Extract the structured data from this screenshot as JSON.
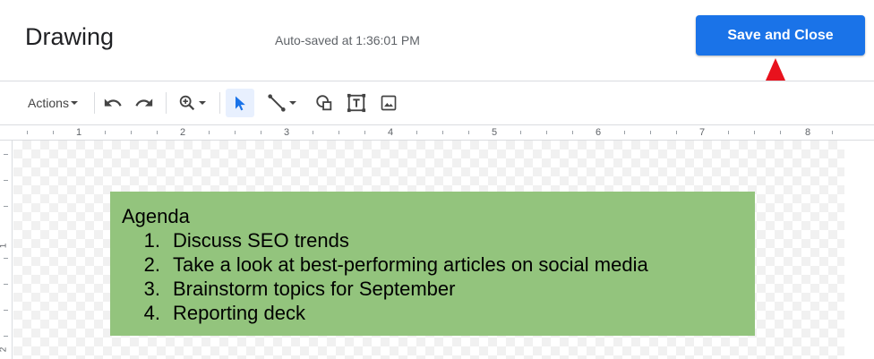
{
  "header": {
    "title": "Drawing",
    "autosave": "Auto-saved at 1:36:01 PM",
    "save_label": "Save and Close"
  },
  "toolbar": {
    "actions_label": "Actions",
    "items": [
      "undo-icon",
      "redo-icon",
      "zoom-icon",
      "select-icon",
      "line-icon",
      "shape-icon",
      "textbox-icon",
      "image-icon"
    ]
  },
  "ruler": {
    "top_labels": [
      "1",
      "2",
      "3",
      "4",
      "5",
      "6",
      "7",
      "8"
    ],
    "left_labels": [
      "1",
      "2"
    ]
  },
  "agenda": {
    "heading": "Agenda",
    "items": [
      {
        "num": "1.",
        "text": "Discuss SEO trends"
      },
      {
        "num": "2.",
        "text": "Take a look at best-performing articles on social media"
      },
      {
        "num": "3.",
        "text": "Brainstorm topics for September"
      },
      {
        "num": "4.",
        "text": "Reporting deck"
      }
    ]
  },
  "colors": {
    "accent": "#1a73e8",
    "box_fill": "#93c47d",
    "arrow": "#e8121d"
  }
}
